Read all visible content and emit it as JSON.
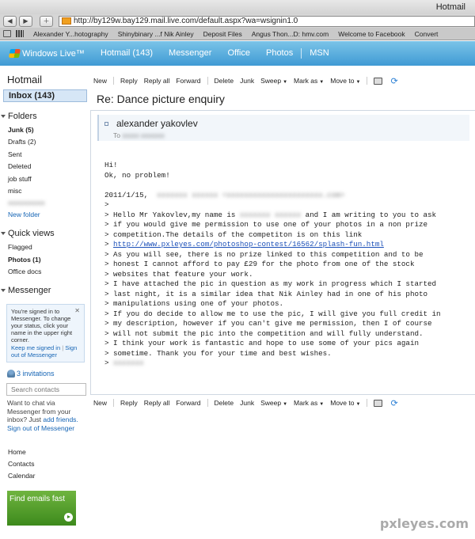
{
  "browser": {
    "window_title": "Hotmail",
    "back_icon": "back-arrow-icon",
    "forward_icon": "forward-arrow-icon",
    "add_icon": "plus-icon",
    "url": "http://by129w.bay129.mail.live.com/default.aspx?wa=wsignin1.0",
    "bookmarks": [
      "Alexander Y...hotography",
      "Shinybinary ...f Nik Ainley",
      "Deposit Files",
      "Angus Thon...D: hmv.com",
      "Welcome to Facebook",
      "Convert"
    ]
  },
  "live_header": {
    "brand": "Windows Live™",
    "nav": [
      "Hotmail (143)",
      "Messenger",
      "Office",
      "Photos",
      "MSN"
    ]
  },
  "sidebar": {
    "title": "Hotmail",
    "inbox": "Inbox (143)",
    "folders_title": "Folders",
    "folders": [
      {
        "label": "Junk (5)",
        "bold": true
      },
      {
        "label": "Drafts (2)",
        "bold": false
      },
      {
        "label": "Sent",
        "bold": false
      },
      {
        "label": "Deleted",
        "bold": false
      },
      {
        "label": "job stuff",
        "bold": false
      },
      {
        "label": "misc",
        "bold": false
      }
    ],
    "new_folder": "New folder",
    "quick_views_title": "Quick views",
    "quick_views": [
      {
        "label": "Flagged",
        "bold": false
      },
      {
        "label": "Photos (1)",
        "bold": true
      },
      {
        "label": "Office docs",
        "bold": false
      }
    ],
    "messenger_title": "Messenger",
    "messenger_box": {
      "text": "You're signed in to Messenger. To change your status, click your name in the upper right corner.",
      "keep_signed_in": "Keep me signed in",
      "sign_out": "Sign out of Messenger"
    },
    "invitations": "3 invitations",
    "search_placeholder": "Search contacts",
    "chat_promo": {
      "text": "Want to chat via Messenger from your inbox? Just",
      "add_friends": "add friends.",
      "sign_out": "Sign out of Messenger"
    },
    "bottom_links": [
      "Home",
      "Contacts",
      "Calendar"
    ],
    "promo": "Find emails fast"
  },
  "actions": {
    "new": "New",
    "reply": "Reply",
    "reply_all": "Reply all",
    "forward": "Forward",
    "delete": "Delete",
    "junk": "Junk",
    "sweep": "Sweep",
    "mark_as": "Mark as",
    "move_to": "Move to",
    "print_icon": "print-icon",
    "refresh_icon": "refresh-icon"
  },
  "message": {
    "subject": "Re: Dance picture enquiry",
    "sender": "alexander yakovlev",
    "to_label": "To",
    "greeting": "Hi!",
    "reply_line": "Ok, no problem!",
    "date_line": "2011/1/15,",
    "quoted_lines": [
      ">",
      "> Hello Mr Yakovlev,my name is",
      "and I am writing to you to ask",
      "> if you would give me permission to use one of your photos in a non prize",
      "> competition.The details of the competiton is on this link",
      "> ",
      "http://www.pxleyes.com/photoshop-contest/16562/splash-fun.html",
      "> As you will see, there is no prize linked to this competition and to be",
      "> honest I cannot afford to pay £29 for the photo from one of the stock",
      "> websites that feature your work.",
      "> I have attached the pic in question as my work in progress which I started",
      "> last night, it is a similar idea that Nik Ainley had in one of his photo",
      "> manipulations using one of your photos.",
      "> If you do decide to allow me to use the pic, I will give you full credit in",
      "> my description, however if you can't give me permission, then I of course",
      "> will not submit the pic into the competition and will fully understand.",
      "> I think your work is fantastic and hope to use some of your pics again",
      "> sometime. Thank you for your time and best wishes.",
      "> "
    ]
  },
  "watermark": "pxleyes.com"
}
